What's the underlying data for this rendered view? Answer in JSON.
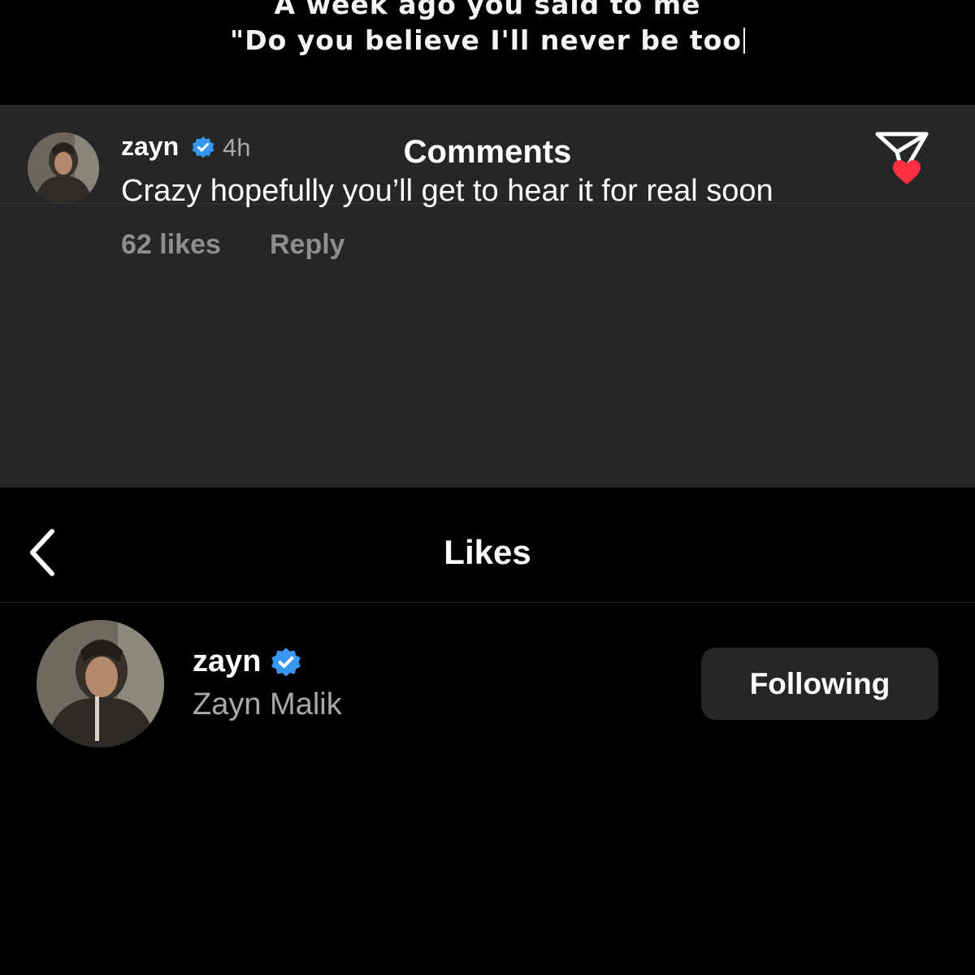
{
  "lyrics": {
    "line1": "A week ago you said to me",
    "line2": "\"Do you believe I'll never be too"
  },
  "comments": {
    "title": "Comments",
    "share_icon": "paper-plane-icon",
    "comment": {
      "username": "zayn",
      "verified": true,
      "time": "4h",
      "text": "Crazy hopefully you’ll get to hear it for real soon",
      "likes": "62 likes",
      "reply_label": "Reply",
      "liked": true
    }
  },
  "likes": {
    "title": "Likes",
    "back_icon": "chevron-left-icon",
    "user": {
      "username": "zayn",
      "verified": true,
      "full_name": "Zayn Malik",
      "follow_label": "Following"
    }
  },
  "colors": {
    "background": "#000000",
    "panel": "#262626",
    "heart": "#ff3040",
    "verified": "#3897f0",
    "muted_text": "#a8a8a8"
  }
}
